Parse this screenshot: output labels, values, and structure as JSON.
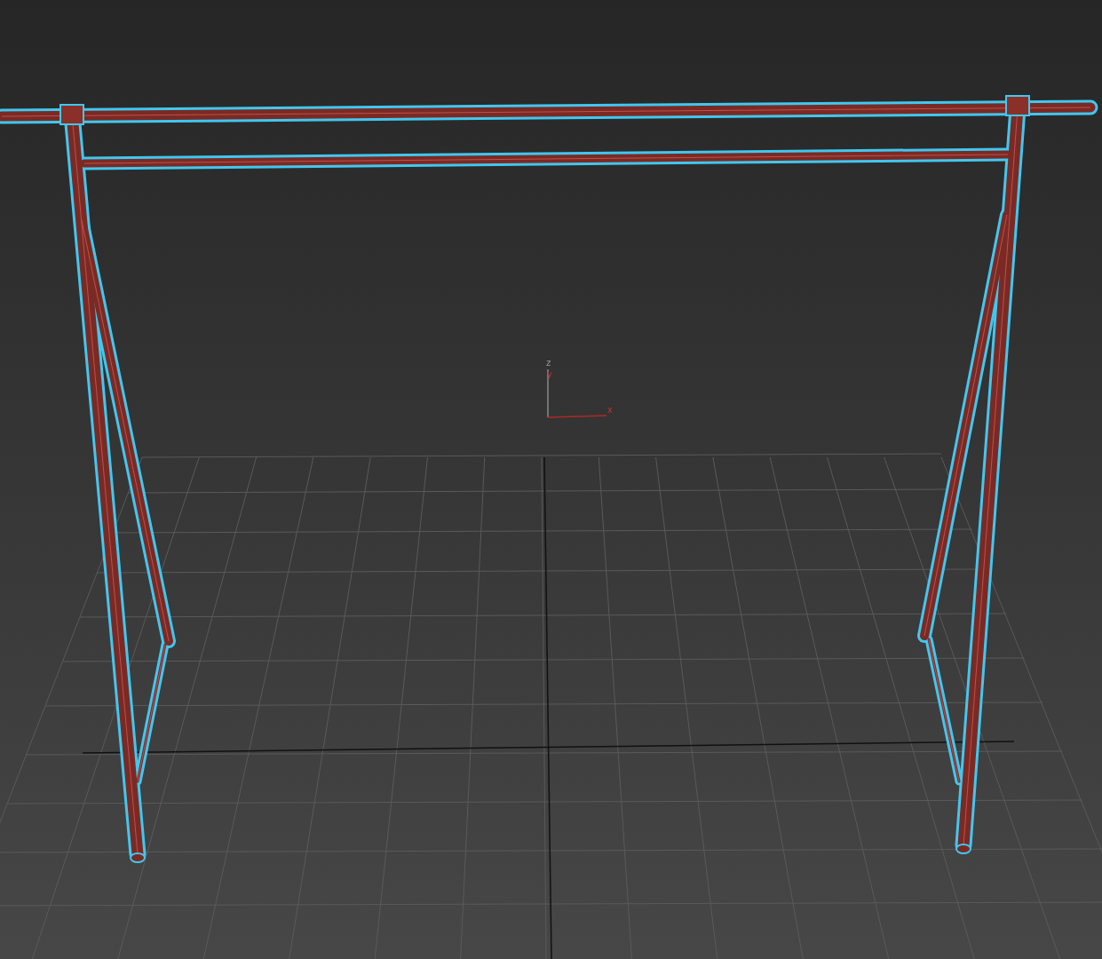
{
  "viewport": {
    "axis_gizmo": {
      "axes": [
        {
          "label": "z"
        },
        {
          "label": "y"
        },
        {
          "label": "x"
        }
      ]
    }
  }
}
